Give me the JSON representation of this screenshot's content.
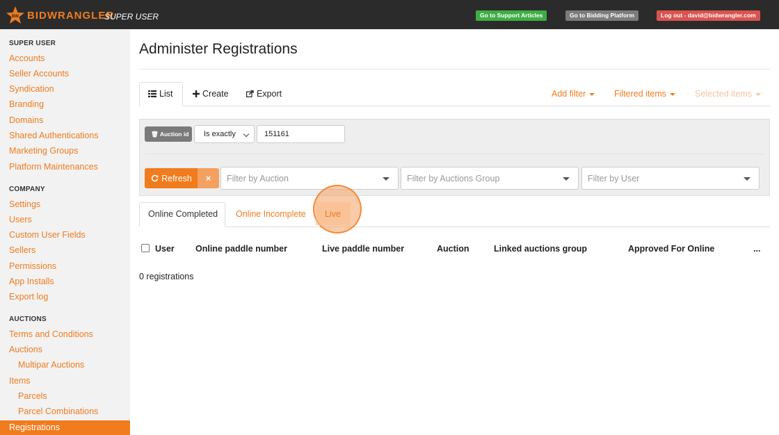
{
  "header": {
    "brand": "BIDWRANGLER",
    "role": "SUPER USER",
    "support_btn": "Go to Support Articles",
    "bidding_btn": "Go to Bidding Platform",
    "logout_btn": "Log out - david@bidwrangler.com"
  },
  "sidebar": {
    "sections": [
      {
        "heading": "SUPER USER",
        "items": [
          "Accounts",
          "Seller Accounts",
          "Syndication",
          "Branding",
          "Domains",
          "Shared Authentications",
          "Marketing Groups",
          "Platform Maintenances"
        ]
      },
      {
        "heading": "COMPANY",
        "items": [
          "Settings",
          "Users",
          "Custom User Fields",
          "Sellers",
          "Permissions",
          "App Installs",
          "Export log"
        ]
      },
      {
        "heading": "AUCTIONS",
        "items": [
          "Terms and Conditions",
          "Auctions",
          "Multipar Auctions",
          "Items",
          "Parcels",
          "Parcel Combinations",
          "Registrations"
        ]
      }
    ],
    "active": "Registrations"
  },
  "page": {
    "title": "Administer Registrations"
  },
  "toolbar": {
    "list": "List",
    "create": "Create",
    "export": "Export",
    "add_filter": "Add filter",
    "filtered_items": "Filtered items",
    "selected_items": "Selected items"
  },
  "filter": {
    "field_label": "Auction id",
    "operator": "Is exactly",
    "value": "151161",
    "refresh": "Refresh",
    "clear": "×",
    "by_auction": "Filter by Auction",
    "by_group": "Filter by Auctions Group",
    "by_user": "Filter by User"
  },
  "subtabs": {
    "completed": "Online Completed",
    "incomplete": "Online Incomplete",
    "live": "Live"
  },
  "table": {
    "columns": [
      "User",
      "Online paddle number",
      "Live paddle number",
      "Auction",
      "Linked auctions group",
      "Approved For Online",
      "..."
    ],
    "count_text": "0 registrations"
  },
  "colors": {
    "accent": "#f07c1e",
    "topbar": "#2b2b2b",
    "support": "#3fad46",
    "logout": "#d9534f"
  }
}
